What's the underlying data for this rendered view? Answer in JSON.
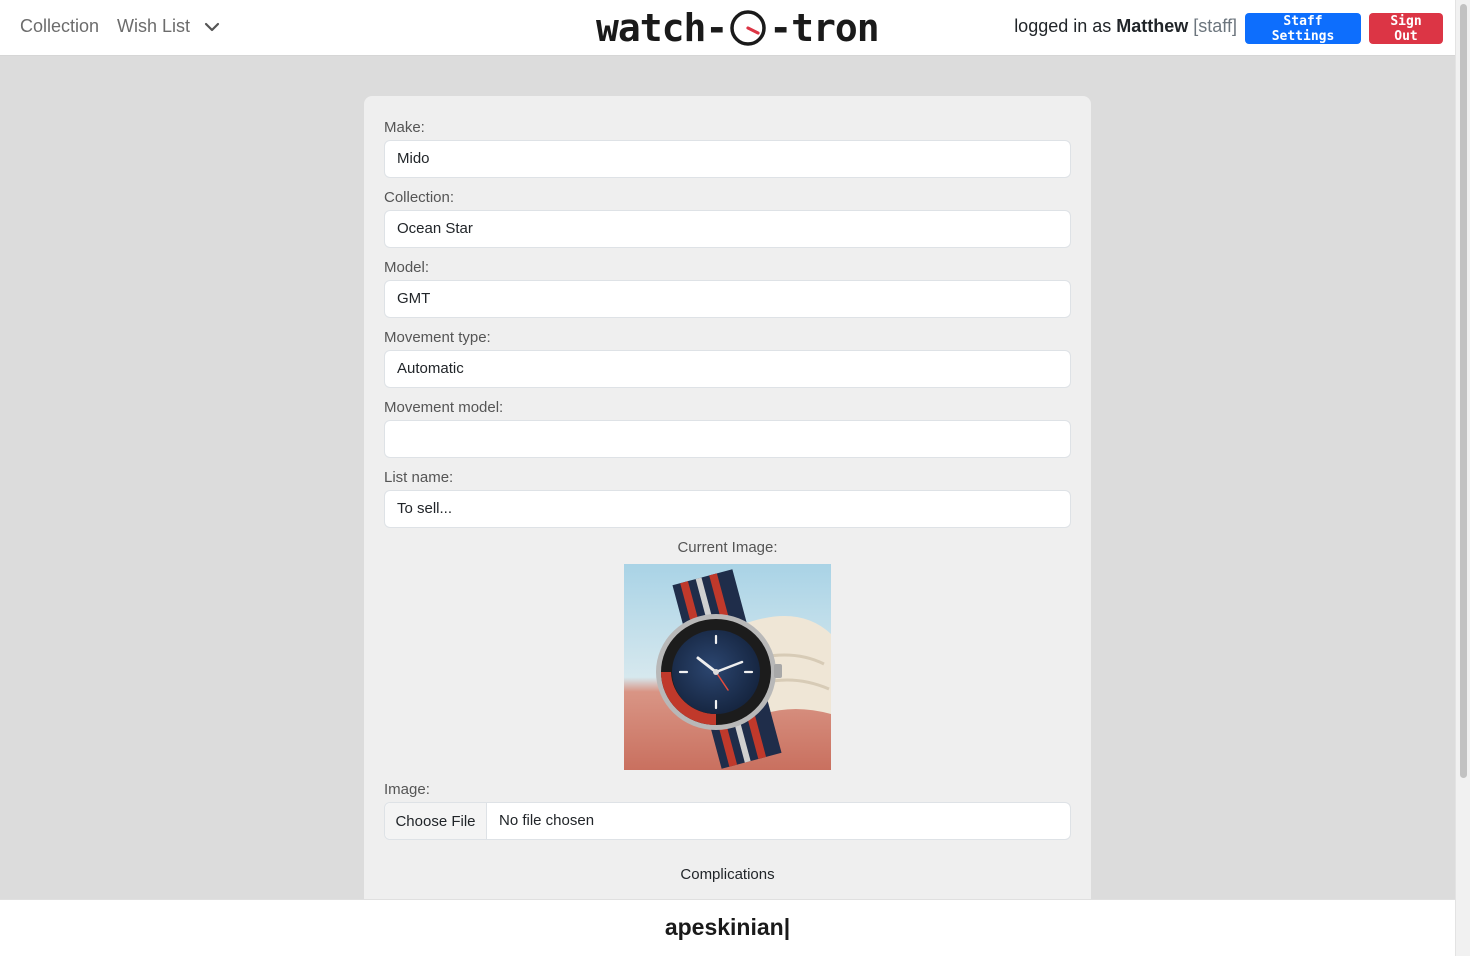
{
  "nav": {
    "collection": "Collection",
    "wish_list": "Wish List",
    "logo_left": "watch-",
    "logo_right": "-tron",
    "logged_in_prefix": "logged in as",
    "user_name": "Matthew",
    "user_role": "[staff]",
    "staff_settings": "Staff Settings",
    "sign_out": "Sign Out"
  },
  "form": {
    "make": {
      "label": "Make:",
      "value": "Mido"
    },
    "collection": {
      "label": "Collection:",
      "value": "Ocean Star"
    },
    "model": {
      "label": "Model:",
      "value": "GMT"
    },
    "movement_type": {
      "label": "Movement type:",
      "value": "Automatic"
    },
    "movement_model": {
      "label": "Movement model:",
      "value": ""
    },
    "list_name": {
      "label": "List name:",
      "value": "To sell..."
    },
    "current_image_label": "Current Image:",
    "image": {
      "label": "Image:",
      "button": "Choose File",
      "status": "No file chosen"
    },
    "complications": "Complications"
  },
  "footer": {
    "text": "apeskinian|"
  },
  "colors": {
    "primary": "#0d6efd",
    "danger": "#dc3545",
    "page_bg": "#dcdcdc",
    "card_bg": "#efefef"
  },
  "icons": {
    "nav_caret": "chevron-down-icon",
    "logo_dial": "clock-dial-icon"
  }
}
